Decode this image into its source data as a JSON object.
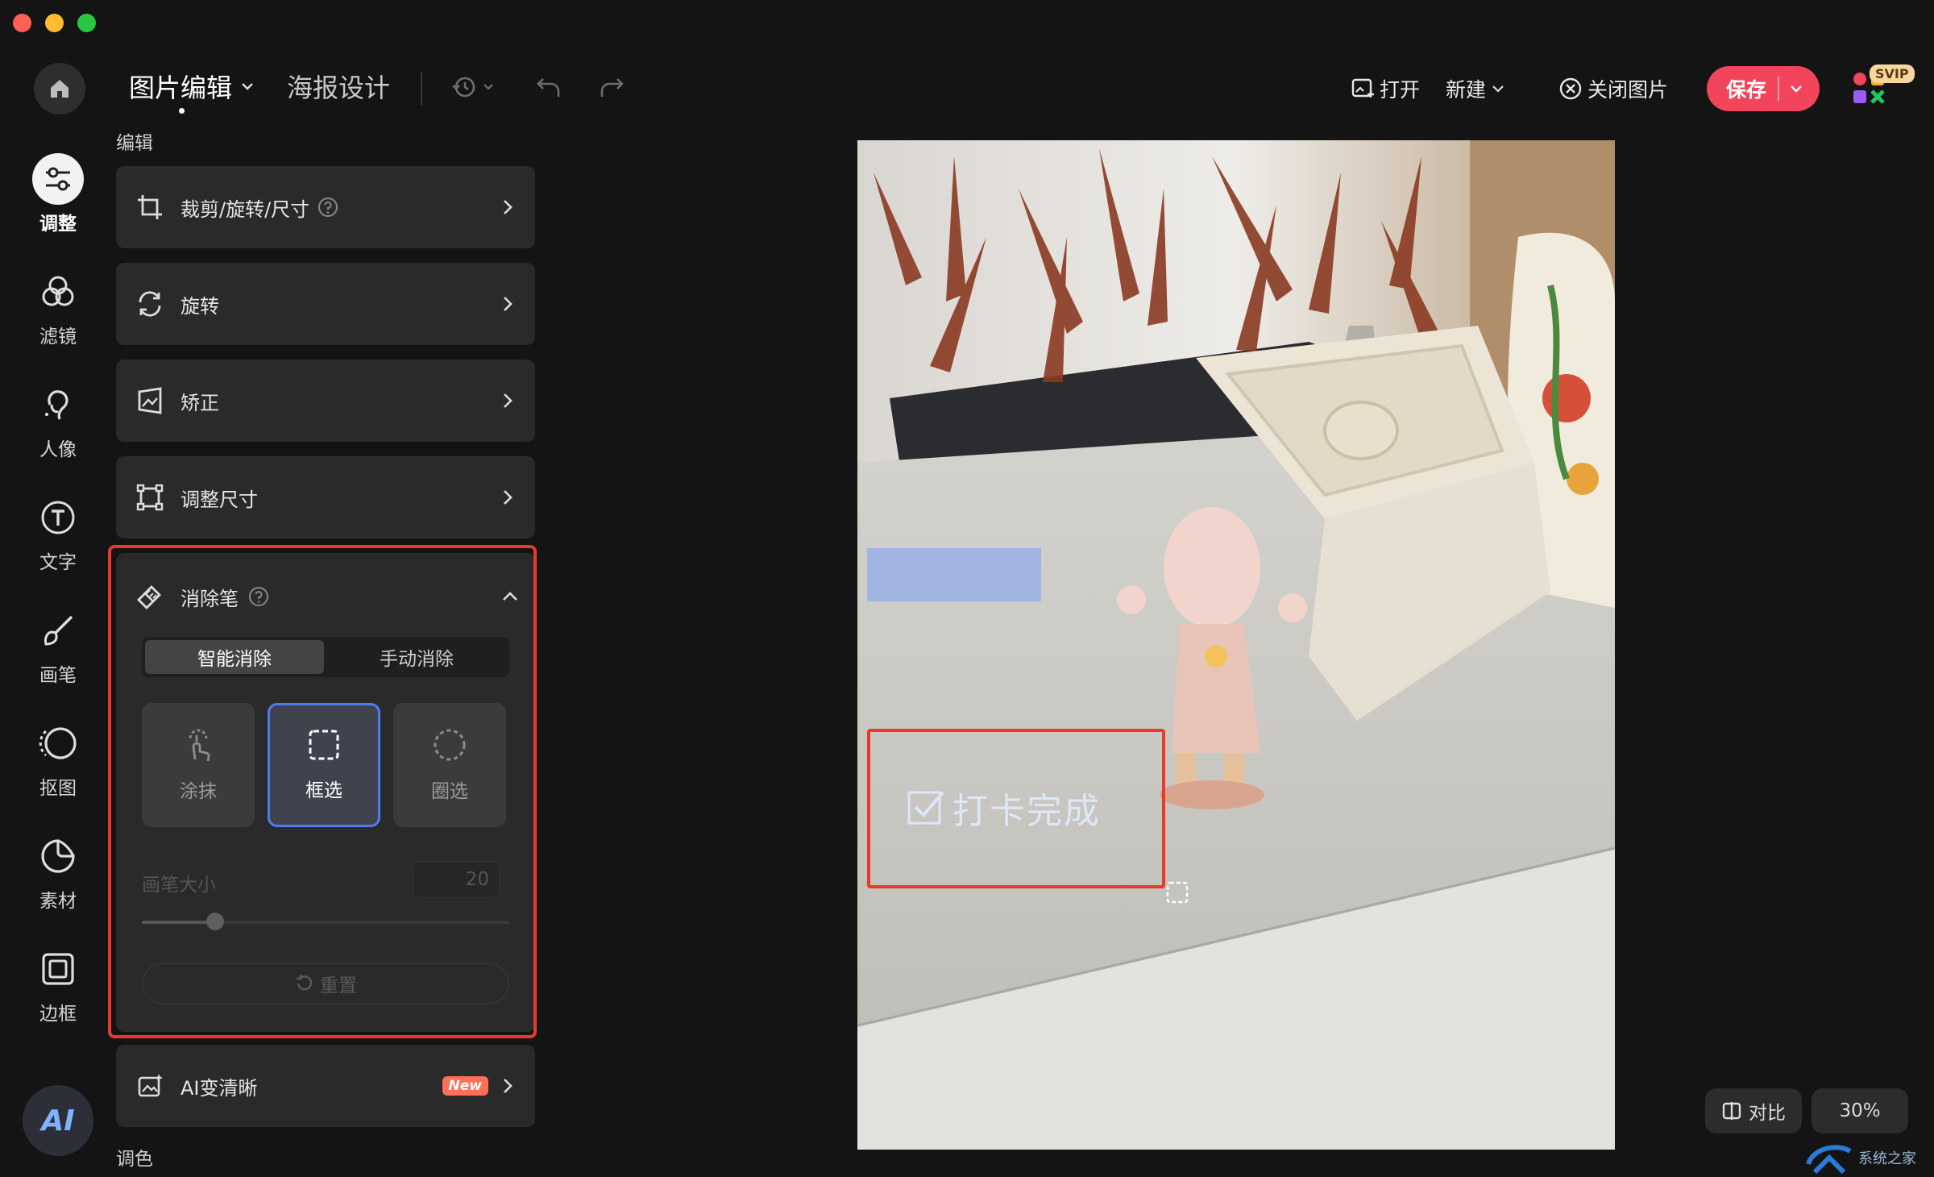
{
  "app": {
    "mode_tabs": [
      {
        "label": "图片编辑",
        "active": true
      },
      {
        "label": "海报设计",
        "active": false
      }
    ]
  },
  "toolbar": {
    "open_label": "打开",
    "new_label": "新建",
    "close_image_label": "关闭图片",
    "save_label": "保存",
    "svip_badge": "SVIP"
  },
  "sidebar": {
    "items": [
      {
        "label": "调整",
        "icon": "sliders-icon",
        "active": true
      },
      {
        "label": "滤镜",
        "icon": "filter-circles-icon"
      },
      {
        "label": "人像",
        "icon": "portrait-icon"
      },
      {
        "label": "文字",
        "icon": "text-icon"
      },
      {
        "label": "画笔",
        "icon": "brush-icon"
      },
      {
        "label": "抠图",
        "icon": "cutout-icon"
      },
      {
        "label": "素材",
        "icon": "sticker-icon"
      },
      {
        "label": "边框",
        "icon": "frame-icon"
      }
    ],
    "ai_label": "AI"
  },
  "panel": {
    "section_edit": "编辑",
    "cards": [
      {
        "label": "裁剪/旋转/尺寸",
        "icon": "crop-icon",
        "help": true
      },
      {
        "label": "旋转",
        "icon": "rotate-icon"
      },
      {
        "label": "矫正",
        "icon": "perspective-icon"
      },
      {
        "label": "调整尺寸",
        "icon": "resize-icon"
      }
    ],
    "eraser": {
      "title": "消除笔",
      "mode_tabs": [
        {
          "label": "智能消除",
          "active": true
        },
        {
          "label": "手动消除",
          "active": false
        }
      ],
      "tools": [
        {
          "label": "涂抹",
          "icon": "smear-icon",
          "selected": false
        },
        {
          "label": "框选",
          "icon": "rect-select-icon",
          "selected": true
        },
        {
          "label": "圈选",
          "icon": "lasso-icon",
          "selected": false
        }
      ],
      "brush_size_label": "画笔大小",
      "brush_size_value": "20",
      "brush_size_fraction": 0.2,
      "reset_label": "重置"
    },
    "ai_clear_label": "AI变清晰",
    "ai_clear_badge": "New",
    "section_color": "调色"
  },
  "canvas": {
    "selection_text": "打卡完成"
  },
  "bottom": {
    "compare_label": "对比",
    "zoom_label": "30%"
  },
  "watermark": {
    "text": "系统之家"
  },
  "colors": {
    "accent_red": "#f2445a",
    "highlight_box": "#e8392a",
    "selected_blue": "#4d7cf0"
  }
}
